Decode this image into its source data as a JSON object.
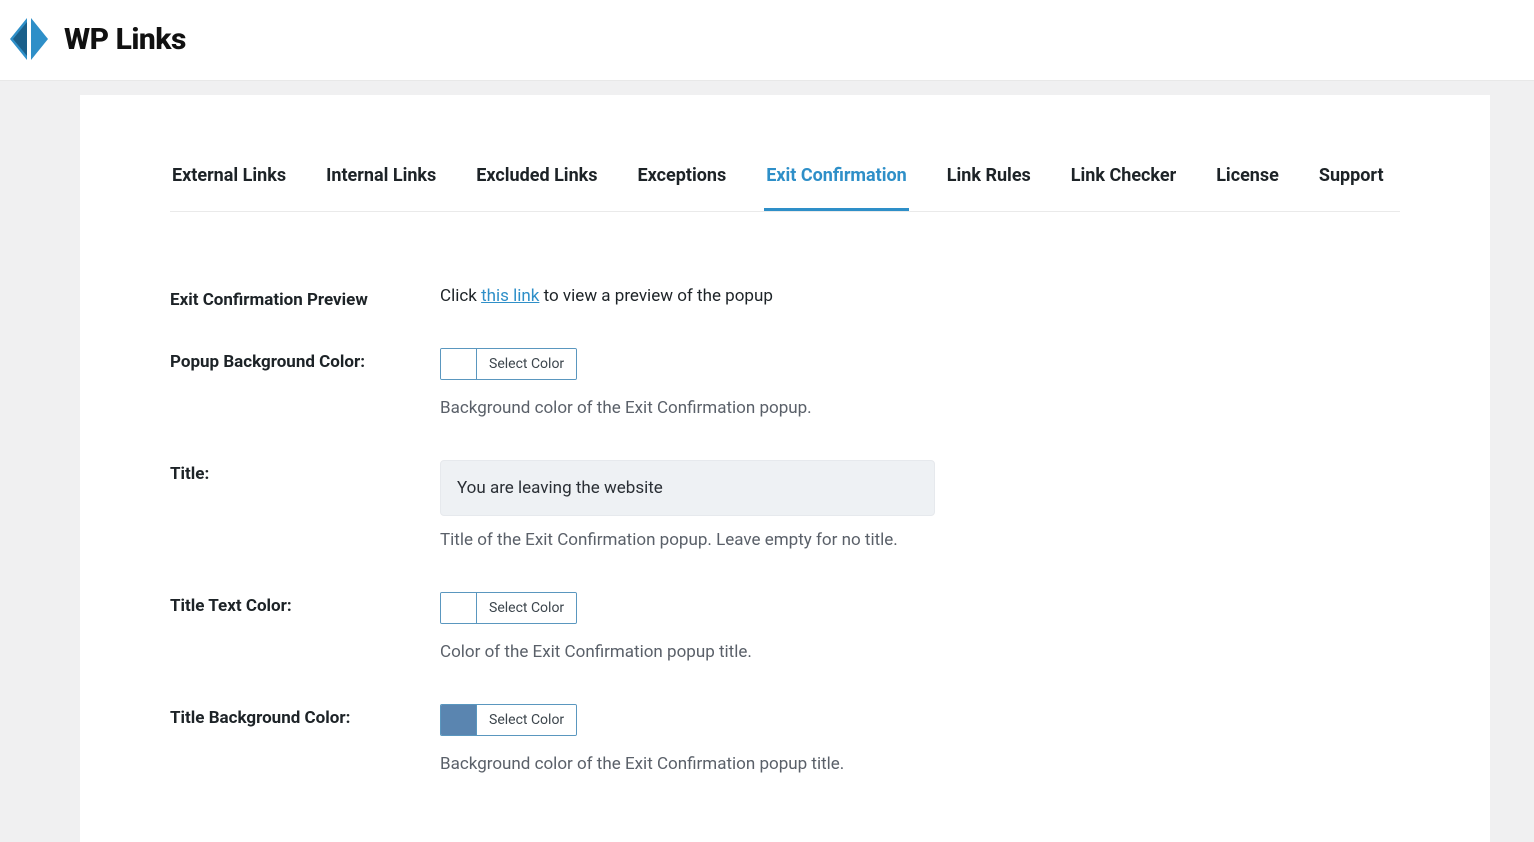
{
  "brand": {
    "name": "WP Links"
  },
  "tabs": [
    {
      "label": "External Links",
      "active": false
    },
    {
      "label": "Internal Links",
      "active": false
    },
    {
      "label": "Excluded Links",
      "active": false
    },
    {
      "label": "Exceptions",
      "active": false
    },
    {
      "label": "Exit Confirmation",
      "active": true
    },
    {
      "label": "Link Rules",
      "active": false
    },
    {
      "label": "Link Checker",
      "active": false
    },
    {
      "label": "License",
      "active": false
    },
    {
      "label": "Support",
      "active": false
    }
  ],
  "rows": {
    "preview": {
      "label": "Exit Confirmation Preview",
      "text_before": "Click ",
      "link_text": "this link",
      "text_after": " to view a preview of the popup"
    },
    "popup_bg": {
      "label": "Popup Background Color:",
      "button_label": "Select Color",
      "swatch": "#ffffff",
      "desc": "Background color of the Exit Confirmation popup."
    },
    "title": {
      "label": "Title:",
      "value": "You are leaving the website",
      "desc": "Title of the Exit Confirmation popup. Leave empty for no title."
    },
    "title_text_color": {
      "label": "Title Text Color:",
      "button_label": "Select Color",
      "swatch": "#ffffff",
      "desc": "Color of the Exit Confirmation popup title."
    },
    "title_bg_color": {
      "label": "Title Background Color:",
      "button_label": "Select Color",
      "swatch": "#5a85b0",
      "desc": "Background color of the Exit Confirmation popup title."
    }
  }
}
